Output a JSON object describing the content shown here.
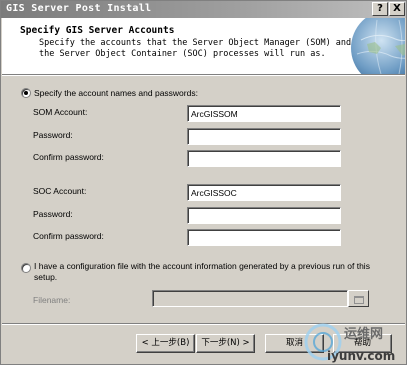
{
  "window": {
    "title": "GIS Server Post Install",
    "help_glyph": "?",
    "close_glyph": "X"
  },
  "header": {
    "title": "Specify GIS Server Accounts",
    "description": "Specify the accounts that the Server Object Manager (SOM) and the Server Object Container (SOC) processes will run as."
  },
  "option_specify": {
    "label": "Specify the account names and passwords:",
    "selected": true
  },
  "som": {
    "account_label": "SOM Account:",
    "account_value": "ArcGISSOM",
    "password_label": "Password:",
    "confirm_label": "Confirm password:"
  },
  "soc": {
    "account_label": "SOC Account:",
    "account_value": "ArcGISSOC",
    "password_label": "Password:",
    "confirm_label": "Confirm password:"
  },
  "option_config": {
    "label_line1": "I have a configuration file with the account information generated by a previous run of this",
    "label_line2": "setup.",
    "selected": false,
    "filename_label": "Filename:",
    "filename_value": ""
  },
  "buttons": {
    "back": "< 上一步(B)",
    "next": "下一步(N) >",
    "cancel": "取消",
    "help": "帮助"
  },
  "watermark": {
    "text": "运维网",
    "url": "iyunv.com"
  }
}
